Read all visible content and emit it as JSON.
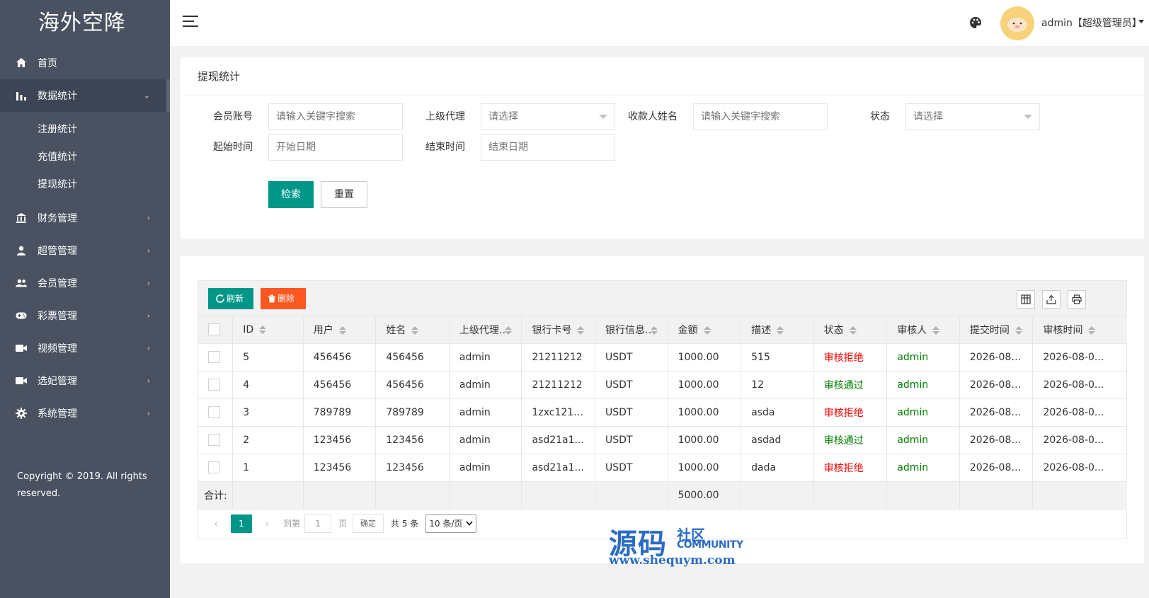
{
  "sidebar": {
    "logo": "海外空降",
    "items": [
      {
        "label": "首页",
        "icon": "home-icon"
      },
      {
        "label": "数据统计",
        "icon": "bar-chart-icon"
      },
      {
        "label": "财务管理",
        "icon": "bank-icon"
      },
      {
        "label": "超管管理",
        "icon": "user-icon"
      },
      {
        "label": "会员管理",
        "icon": "users-icon"
      },
      {
        "label": "彩票管理",
        "icon": "gamepad-icon"
      },
      {
        "label": "视频管理",
        "icon": "video-icon"
      },
      {
        "label": "选妃管理",
        "icon": "video-icon"
      },
      {
        "label": "系统管理",
        "icon": "gear-icon"
      }
    ],
    "subitems": [
      "注册统计",
      "充值统计",
      "提现统计"
    ],
    "copyright": "Copyright © 2019. All rights reserved."
  },
  "header": {
    "user": "admin【超级管理员】"
  },
  "search": {
    "title": "提现统计",
    "fields": {
      "account": {
        "label": "会员账号",
        "placeholder": "请输入关键字搜索"
      },
      "agent": {
        "label": "上级代理",
        "placeholder": "请选择"
      },
      "payee": {
        "label": "收款人姓名",
        "placeholder": "请输入关键字搜索"
      },
      "status": {
        "label": "状态",
        "placeholder": "请选择"
      },
      "start": {
        "label": "起始时间",
        "placeholder": "开始日期"
      },
      "end": {
        "label": "结束时间",
        "placeholder": "结束日期"
      }
    },
    "search_label": "检索",
    "reset_label": "重置"
  },
  "toolbar": {
    "refresh_label": "刷新",
    "delete_label": "删除"
  },
  "table": {
    "headers": [
      "ID",
      "用户",
      "姓名",
      "上级代理",
      "银行卡号",
      "银行信息",
      "金额",
      "描述",
      "状态",
      "审核人",
      "提交时间",
      "审核时间"
    ],
    "rows": [
      [
        "5",
        "456456",
        "456456",
        "admin",
        "21211212",
        "USDT",
        "1000.00",
        "515",
        "审核拒绝",
        "admin",
        "2026-08-...",
        "2026-08-0..."
      ],
      [
        "4",
        "456456",
        "456456",
        "admin",
        "21211212",
        "USDT",
        "1000.00",
        "12",
        "审核通过",
        "admin",
        "2026-08-...",
        "2026-08-0..."
      ],
      [
        "3",
        "789789",
        "789789",
        "admin",
        "1zxc1212...",
        "USDT",
        "1000.00",
        "asda",
        "审核拒绝",
        "admin",
        "2026-08-...",
        "2026-08-0..."
      ],
      [
        "2",
        "123456",
        "123456",
        "admin",
        "asd21a1...",
        "USDT",
        "1000.00",
        "asdad",
        "审核通过",
        "admin",
        "2026-08-...",
        "2026-08-0..."
      ],
      [
        "1",
        "123456",
        "123456",
        "admin",
        "asd21a1...",
        "USDT",
        "1000.00",
        "dada",
        "审核拒绝",
        "admin",
        "2026-08-...",
        "2026-08-0..."
      ]
    ],
    "total_label": "合计:",
    "total_amount": "5000.00"
  },
  "pager": {
    "current": "1",
    "goto_label": "到第",
    "goto_value": "1",
    "page_label": "页",
    "confirm_label": "确定",
    "count": "共 5 条",
    "per_page": "10 条/页"
  },
  "watermark": {
    "big": "源码",
    "small": "社区",
    "community": "COMMUNITY",
    "url": "www.shequym.com"
  },
  "colors": {
    "sidebar": "#4a5262",
    "primary": "#009688",
    "danger": "#ff5722",
    "reject": "#ff0000",
    "pass": "#008000"
  }
}
